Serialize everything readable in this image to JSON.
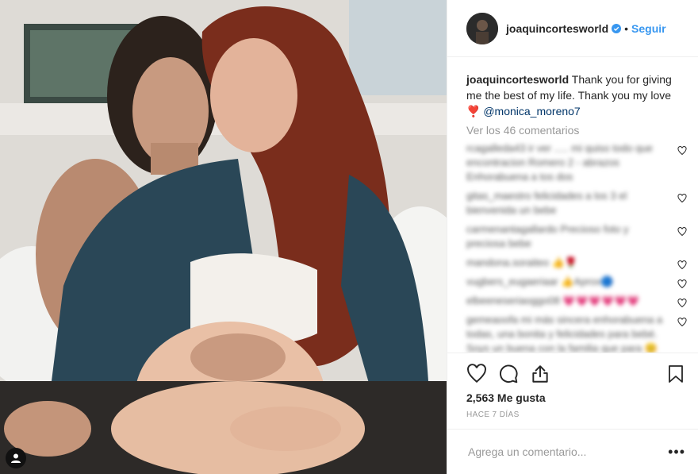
{
  "header": {
    "username": "joaquincortesworld",
    "separator": "•",
    "follow_label": "Seguir"
  },
  "caption": {
    "username": "joaquincortesworld",
    "text": " Thank you for giving me the best of my life. Thank you my love ",
    "heart": "❣️",
    "mention": "@monica_moreno7"
  },
  "view_all_comments": "Ver los 46 comentarios",
  "comments_blurred": [
    "rcagalleda43 ir ver ..... mi quiso todo que encontracion Romero 2 - abrazos Enhorabuena a tos dos",
    "gitas_maestro felicidades a los 3 el bienvenida un bebe",
    "carmenantagallardo Precioso foto y preciosa bebe",
    "mandona.soraiteo 👍🌹",
    "vugbers_eugaeriaar 👍Aprox🔵",
    "elbeeneseriaoggo08 💗💗💗💗💗💗",
    "gemeaoofa mi más sincera enhorabuena a todas, una bonita y felicidades para bebé. Soys un buena con la familia que para 😊"
  ],
  "likes": "2,563 Me gusta",
  "date": "HACE 7 DÍAS",
  "add_comment_placeholder": "Agrega un comentario...",
  "more_label": "•••",
  "colors": {
    "link": "#3897f0",
    "mention": "#003569",
    "muted": "#999999",
    "border": "#efefef"
  },
  "icons": [
    "verified-badge-icon",
    "heart-icon",
    "comment-icon",
    "share-icon",
    "bookmark-icon",
    "user-tag-icon",
    "more-options-icon"
  ]
}
